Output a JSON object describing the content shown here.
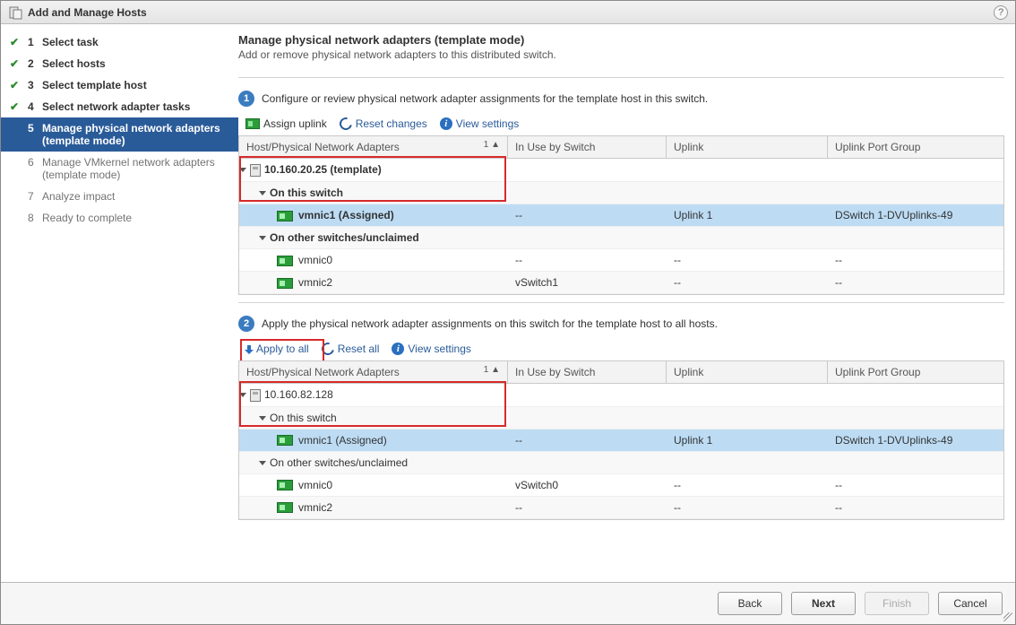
{
  "window": {
    "title": "Add and Manage Hosts"
  },
  "steps": [
    {
      "num": "1",
      "label": "Select task",
      "state": "done"
    },
    {
      "num": "2",
      "label": "Select hosts",
      "state": "done"
    },
    {
      "num": "3",
      "label": "Select template host",
      "state": "done"
    },
    {
      "num": "4",
      "label": "Select network adapter tasks",
      "state": "done"
    },
    {
      "num": "5",
      "label": "Manage physical network adapters (template mode)",
      "state": "active"
    },
    {
      "num": "6",
      "label": "Manage VMkernel network adapters (template mode)",
      "state": "pending"
    },
    {
      "num": "7",
      "label": "Analyze impact",
      "state": "pending"
    },
    {
      "num": "8",
      "label": "Ready to complete",
      "state": "pending"
    }
  ],
  "page": {
    "heading": "Manage physical network adapters (template mode)",
    "subtitle": "Add or remove physical network adapters to this distributed switch."
  },
  "section1": {
    "num": "1",
    "text": "Configure or review physical network adapter assignments for the template host in this switch.",
    "toolbar": {
      "assign": "Assign uplink",
      "reset": "Reset changes",
      "view": "View settings"
    },
    "columns": {
      "c1": "Host/Physical Network Adapters",
      "sort": "1 ▲",
      "c2": "In Use by Switch",
      "c3": "Uplink",
      "c4": "Uplink Port Group"
    },
    "rows": {
      "host": "10.160.20.25 (template)",
      "grp1": "On this switch",
      "r1": {
        "name": "vmnic1 (Assigned)",
        "inuse": "--",
        "uplink": "Uplink 1",
        "upg": "DSwitch 1-DVUplinks-49"
      },
      "grp2": "On other switches/unclaimed",
      "r2": {
        "name": "vmnic0",
        "inuse": "--",
        "uplink": "--",
        "upg": "--"
      },
      "r3": {
        "name": "vmnic2",
        "inuse": "vSwitch1",
        "uplink": "--",
        "upg": "--"
      }
    }
  },
  "section2": {
    "num": "2",
    "text": "Apply the physical network adapter assignments on this switch for the template host to all hosts.",
    "toolbar": {
      "apply": "Apply to all",
      "reset": "Reset all",
      "view": "View settings"
    },
    "columns": {
      "c1": "Host/Physical Network Adapters",
      "sort": "1 ▲",
      "c2": "In Use by Switch",
      "c3": "Uplink",
      "c4": "Uplink Port Group"
    },
    "rows": {
      "host": "10.160.82.128",
      "grp1": "On this switch",
      "r1": {
        "name": "vmnic1 (Assigned)",
        "inuse": "--",
        "uplink": "Uplink 1",
        "upg": "DSwitch 1-DVUplinks-49"
      },
      "grp2": "On other switches/unclaimed",
      "r2": {
        "name": "vmnic0",
        "inuse": "vSwitch0",
        "uplink": "--",
        "upg": "--"
      },
      "r3": {
        "name": "vmnic2",
        "inuse": "--",
        "uplink": "--",
        "upg": "--"
      }
    }
  },
  "footer": {
    "back": "Back",
    "next": "Next",
    "finish": "Finish",
    "cancel": "Cancel"
  }
}
